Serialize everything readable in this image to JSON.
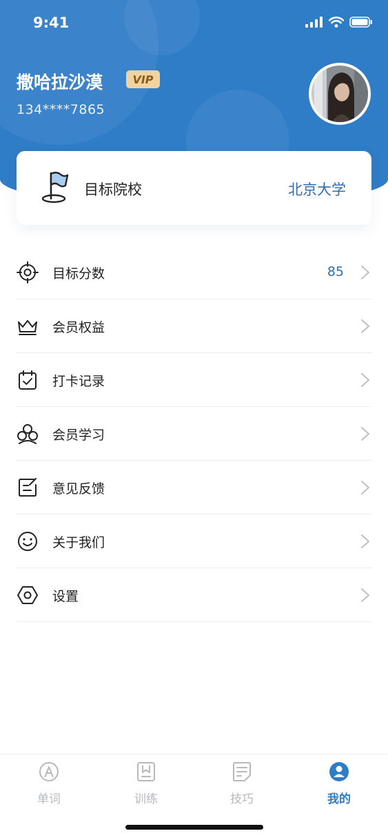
{
  "status_bar": {
    "time": "9:41"
  },
  "user": {
    "name": "撒哈拉沙漠",
    "badge": "VIP",
    "phone": "134****7865"
  },
  "target_school": {
    "label": "目标院校",
    "value": "北京大学"
  },
  "menu": [
    {
      "label": "目标分数",
      "value": "85",
      "icon": "target-icon"
    },
    {
      "label": "会员权益",
      "value": "",
      "icon": "crown-icon"
    },
    {
      "label": "打卡记录",
      "value": "",
      "icon": "calendar-check-icon"
    },
    {
      "label": "会员学习",
      "value": "",
      "icon": "group-icon"
    },
    {
      "label": "意见反馈",
      "value": "",
      "icon": "feedback-icon"
    },
    {
      "label": "关于我们",
      "value": "",
      "icon": "smile-icon"
    },
    {
      "label": "设置",
      "value": "",
      "icon": "settings-icon"
    }
  ],
  "tabbar": [
    {
      "label": "单词",
      "icon": "word-icon",
      "active": false
    },
    {
      "label": "训练",
      "icon": "bookmark-book-icon",
      "active": false
    },
    {
      "label": "技巧",
      "icon": "notes-icon",
      "active": false
    },
    {
      "label": "我的",
      "icon": "profile-icon",
      "active": true
    }
  ],
  "colors": {
    "primary": "#2f7cc7",
    "accent_text": "#2f6fb0",
    "vip_bg": "#f1d3a1",
    "inactive_tab": "#b5b9bf"
  }
}
